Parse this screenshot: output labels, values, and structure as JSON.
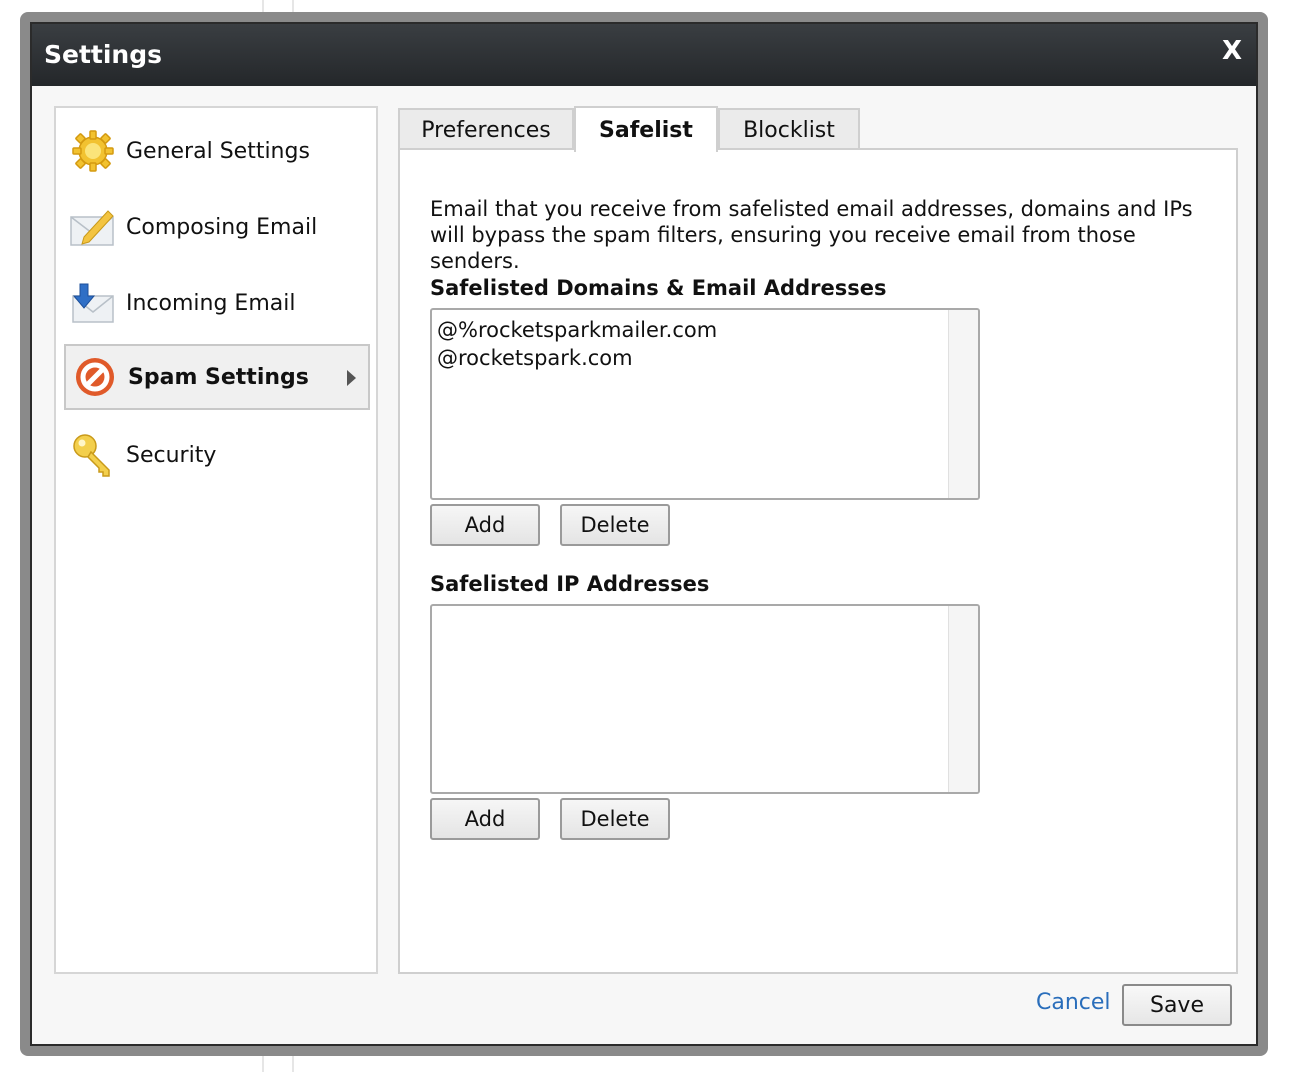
{
  "dialog": {
    "title": "Settings",
    "close_label": "X"
  },
  "sidebar": {
    "items": [
      {
        "label": "General Settings",
        "icon": "gear-icon"
      },
      {
        "label": "Composing Email",
        "icon": "envelope-pencil-icon"
      },
      {
        "label": "Incoming Email",
        "icon": "envelope-download-icon"
      },
      {
        "label": "Spam Settings",
        "icon": "prohibited-icon",
        "active": true
      },
      {
        "label": "Security",
        "icon": "key-icon"
      }
    ]
  },
  "tabs": [
    {
      "label": "Preferences"
    },
    {
      "label": "Safelist",
      "active": true
    },
    {
      "label": "Blocklist"
    }
  ],
  "safelist": {
    "description": "Email that you receive from safelisted email addresses, domains and IPs will bypass the spam filters, ensuring you receive email from those senders.",
    "domains_label": "Safelisted Domains & Email Addresses",
    "domains": [
      "@%rocketsparkmailer.com",
      "@rocketspark.com"
    ],
    "ips_label": "Safelisted IP Addresses",
    "ips": [],
    "add_label": "Add",
    "delete_label": "Delete"
  },
  "footer": {
    "cancel_label": "Cancel",
    "save_label": "Save"
  },
  "colors": {
    "titlebar": "#2b2e31",
    "link": "#2a6ebb",
    "prohibited": "#e05a2a",
    "gear": "#f2c230"
  }
}
